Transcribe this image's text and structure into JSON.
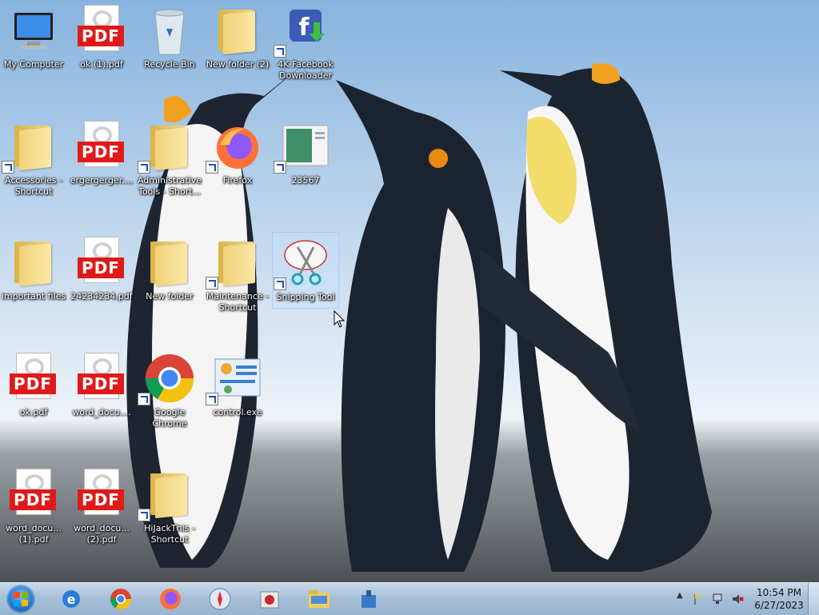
{
  "desktop": {
    "icons": [
      {
        "label": "My Computer",
        "type": "computer",
        "shortcut": false
      },
      {
        "label": "ok (1).pdf",
        "type": "pdf",
        "shortcut": false
      },
      {
        "label": "Recycle Bin",
        "type": "recycle-bin",
        "shortcut": false
      },
      {
        "label": "New folder (2)",
        "type": "folder",
        "shortcut": false
      },
      {
        "label": "4K Facebook Downloader",
        "type": "app-facebook-downloader",
        "shortcut": true
      },
      {
        "label": "Accessories - Shortcut",
        "type": "folder",
        "shortcut": true
      },
      {
        "label": "ergergerger....",
        "type": "pdf",
        "shortcut": false
      },
      {
        "label": "Administrative Tools - Short...",
        "type": "folder",
        "shortcut": true
      },
      {
        "label": "Firefox",
        "type": "firefox",
        "shortcut": true
      },
      {
        "label": "23567",
        "type": "image",
        "shortcut": true
      },
      {
        "label": "important files",
        "type": "folder",
        "shortcut": false
      },
      {
        "label": "24234234.pdf",
        "type": "pdf",
        "shortcut": false
      },
      {
        "label": "New folder",
        "type": "folder",
        "shortcut": false
      },
      {
        "label": "Maintenance - Shortcut",
        "type": "folder",
        "shortcut": true
      },
      {
        "label": "Snipping Tool",
        "type": "snipping-tool",
        "shortcut": true,
        "selected": true
      },
      {
        "label": "ok.pdf",
        "type": "pdf",
        "shortcut": false
      },
      {
        "label": "word_docu....",
        "type": "pdf",
        "shortcut": false
      },
      {
        "label": "Google Chrome",
        "type": "chrome",
        "shortcut": true
      },
      {
        "label": "control.exe",
        "type": "control-panel",
        "shortcut": true
      },
      {
        "label": "word_docu... (1).pdf",
        "type": "pdf",
        "shortcut": false
      },
      {
        "label": "word_docu... (2).pdf",
        "type": "pdf",
        "shortcut": false
      },
      {
        "label": "HiJackThis - Shortcut",
        "type": "folder",
        "shortcut": true
      }
    ],
    "pdf_badge": "PDF"
  },
  "taskbar": {
    "start_label": "Start",
    "pinned": [
      "internet-explorer-icon",
      "chrome-icon",
      "firefox-icon",
      "safari-icon",
      "hijackthis-icon",
      "file-explorer-icon",
      "network-app-icon"
    ],
    "clock": {
      "time": "10:54 PM",
      "date": "6/27/2023"
    },
    "tray_arrow": "▲"
  }
}
